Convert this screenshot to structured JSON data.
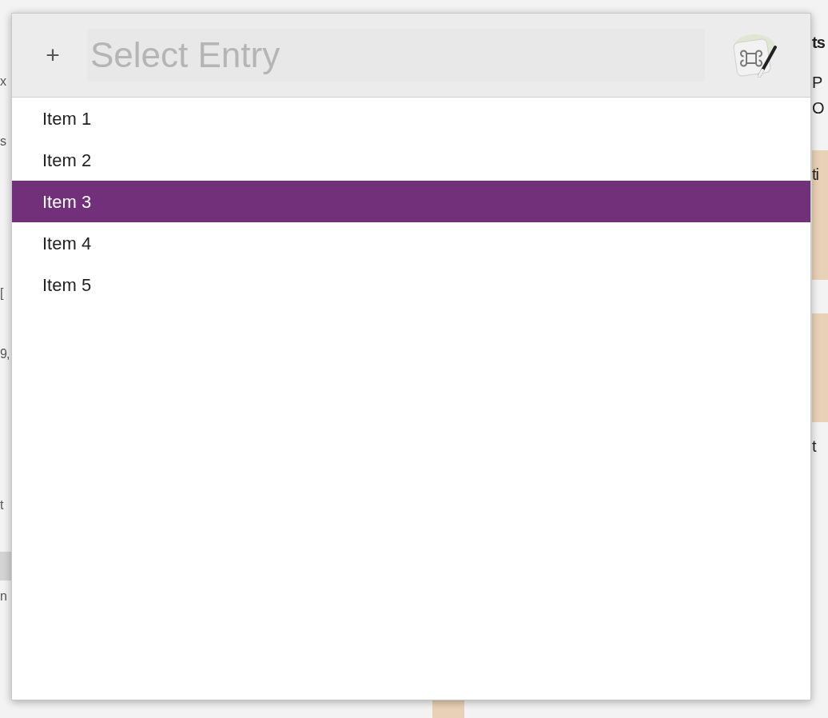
{
  "background_window": {
    "left_fragments": [
      "x",
      "s",
      "[",
      "9,",
      "t",
      "n"
    ],
    "right_fragments": [
      "ts",
      "P",
      "O",
      "ti",
      "t"
    ]
  },
  "prompt": {
    "add_button": "+",
    "search": {
      "placeholder": "Select Entry"
    },
    "items": [
      {
        "label": "Item 1",
        "selected": false
      },
      {
        "label": "Item 2",
        "selected": false
      },
      {
        "label": "Item 3",
        "selected": true
      },
      {
        "label": "Item 4",
        "selected": false
      },
      {
        "label": "Item 5",
        "selected": false
      }
    ]
  }
}
